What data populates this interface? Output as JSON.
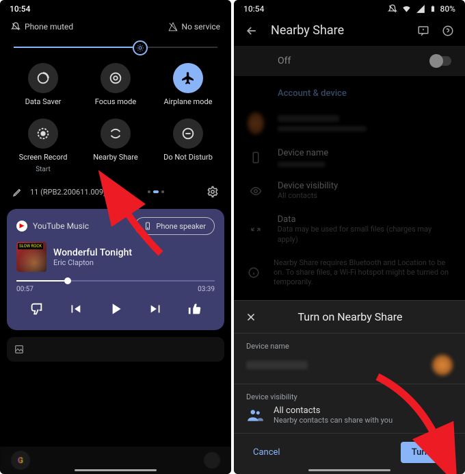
{
  "left": {
    "time": "10:54",
    "sub_status": {
      "muted": "Phone muted",
      "network": "No service"
    },
    "brightness_percent": 62,
    "tiles": [
      {
        "name": "data-saver",
        "label": "Data Saver",
        "sub": "",
        "active": false
      },
      {
        "name": "focus-mode",
        "label": "Focus mode",
        "sub": "",
        "active": false
      },
      {
        "name": "airplane",
        "label": "Airplane mode",
        "sub": "",
        "active": true
      },
      {
        "name": "screen-record",
        "label": "Screen Record",
        "sub": "Start",
        "active": false
      },
      {
        "name": "nearby-share",
        "label": "Nearby Share",
        "sub": "",
        "active": false
      },
      {
        "name": "dnd",
        "label": "Do Not Disturb",
        "sub": "",
        "active": false
      }
    ],
    "build_label": "11 (RPB2.200611.009)",
    "media": {
      "app": "YouTube Music",
      "output": "Phone speaker",
      "album_tag": "SLOW ROCK",
      "title": "Wonderful Tonight",
      "artist": "Eric Clapton",
      "elapsed": "00:57",
      "duration": "03:39",
      "progress_percent": 26
    }
  },
  "right": {
    "time": "10:54",
    "battery": "80%",
    "header_title": "Nearby Share",
    "toggle_state": "Off",
    "section_account": "Account & device",
    "settings": {
      "device_name": {
        "label": "Device name"
      },
      "visibility": {
        "label": "Device visibility",
        "value": "All contacts"
      },
      "data": {
        "label": "Data",
        "value": "Data may be used for small files (charges may apply)"
      },
      "info": {
        "value": "Nearby Share requires Bluetooth and Location to be on. To share files, a Wi-Fi hotspot might be turned on temporarily."
      }
    },
    "sheet": {
      "title": "Turn on Nearby Share",
      "device_name_label": "Device name",
      "visibility_label": "Device visibility",
      "visibility_value": "All contacts",
      "visibility_hint": "Nearby contacts can share with you",
      "cancel": "Cancel",
      "confirm": "Turn on"
    }
  }
}
